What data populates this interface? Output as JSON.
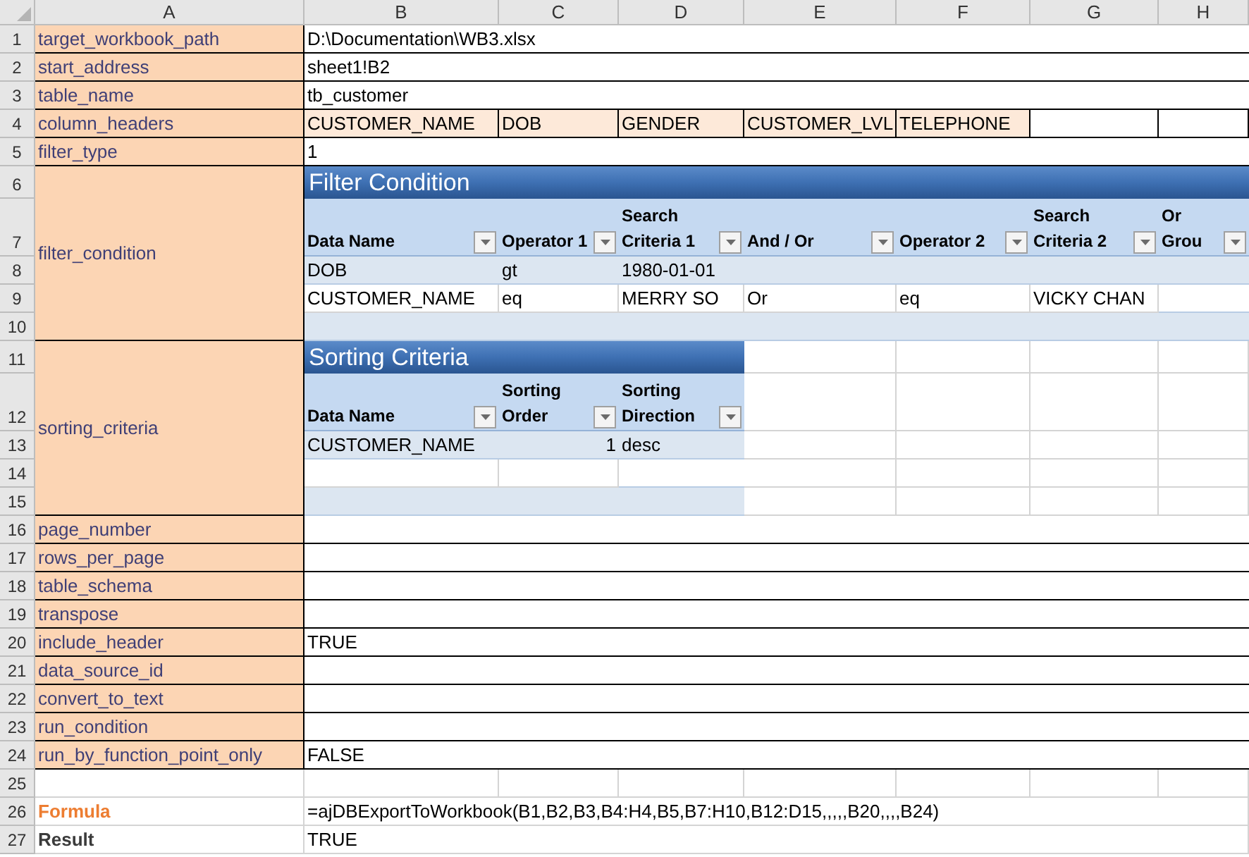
{
  "column_letters": [
    "A",
    "B",
    "C",
    "D",
    "E",
    "F",
    "G",
    "H"
  ],
  "row_numbers": [
    "1",
    "2",
    "3",
    "4",
    "5",
    "6",
    "7",
    "8",
    "9",
    "10",
    "11",
    "12",
    "13",
    "14",
    "15",
    "16",
    "17",
    "18",
    "19",
    "20",
    "21",
    "22",
    "23",
    "24",
    "25",
    "26",
    "27"
  ],
  "parameters": [
    {
      "kind": "text",
      "name": "target_workbook_path",
      "value": "D:\\Documentation\\WB3.xlsx"
    },
    {
      "kind": "text",
      "name": "start_address",
      "value": "sheet1!B2"
    },
    {
      "kind": "text",
      "name": "table_name",
      "value": "tb_customer"
    },
    {
      "kind": "list",
      "name": "column_headers",
      "values": [
        "CUSTOMER_NAME",
        "DOB",
        "GENDER",
        "CUSTOMER_LVL",
        "TELEPHONE"
      ]
    },
    {
      "kind": "text",
      "name": "filter_type",
      "value": "1"
    },
    {
      "kind": "table",
      "name": "filter_condition",
      "table": {
        "title": "Filter Condition",
        "columns": [
          {
            "label": "Data Name",
            "kind": "text"
          },
          {
            "label": "Operator 1",
            "kind": "text"
          },
          {
            "label": "Search Criteria 1",
            "kind": "text"
          },
          {
            "label": "And / Or",
            "kind": "text"
          },
          {
            "label": "Operator 2",
            "kind": "text"
          },
          {
            "label": "Search Criteria 2",
            "kind": "text"
          },
          {
            "label": "Or Grou",
            "kind": "text"
          }
        ],
        "rows": [
          [
            "DOB",
            "gt",
            "1980-01-01",
            null,
            null,
            null,
            null
          ],
          [
            "CUSTOMER_NAME",
            "eq",
            "MERRY SO",
            "Or",
            "eq",
            "VICKY CHAN",
            null
          ]
        ]
      }
    },
    {
      "kind": "table",
      "name": "sorting_criteria",
      "table": {
        "title": "Sorting Criteria",
        "columns": [
          {
            "label": "Data Name",
            "kind": "text"
          },
          {
            "label": "Sorting Order",
            "kind": "number"
          },
          {
            "label": "Sorting Direction",
            "kind": "text"
          }
        ],
        "rows": [
          [
            "CUSTOMER_NAME",
            "1",
            "desc"
          ]
        ]
      }
    },
    {
      "kind": "text",
      "name": "page_number"
    },
    {
      "kind": "text",
      "name": "rows_per_page"
    },
    {
      "kind": "text",
      "name": "table_schema"
    },
    {
      "kind": "text",
      "name": "transpose"
    },
    {
      "kind": "text",
      "name": "include_header",
      "value": "TRUE"
    },
    {
      "kind": "text",
      "name": "data_source_id"
    },
    {
      "kind": "text",
      "name": "convert_to_text"
    },
    {
      "kind": "text",
      "name": "run_condition"
    },
    {
      "kind": "text",
      "name": "run_by_function_point_only",
      "value": "FALSE"
    }
  ],
  "formula": {
    "label": "Formula",
    "value": "=ajDBExportToWorkbook(B1,B2,B3,B4:H4,B5,B7:H10,B12:D15,,,,,B20,,,,B24)"
  },
  "result": {
    "label": "Result",
    "value": "TRUE"
  }
}
